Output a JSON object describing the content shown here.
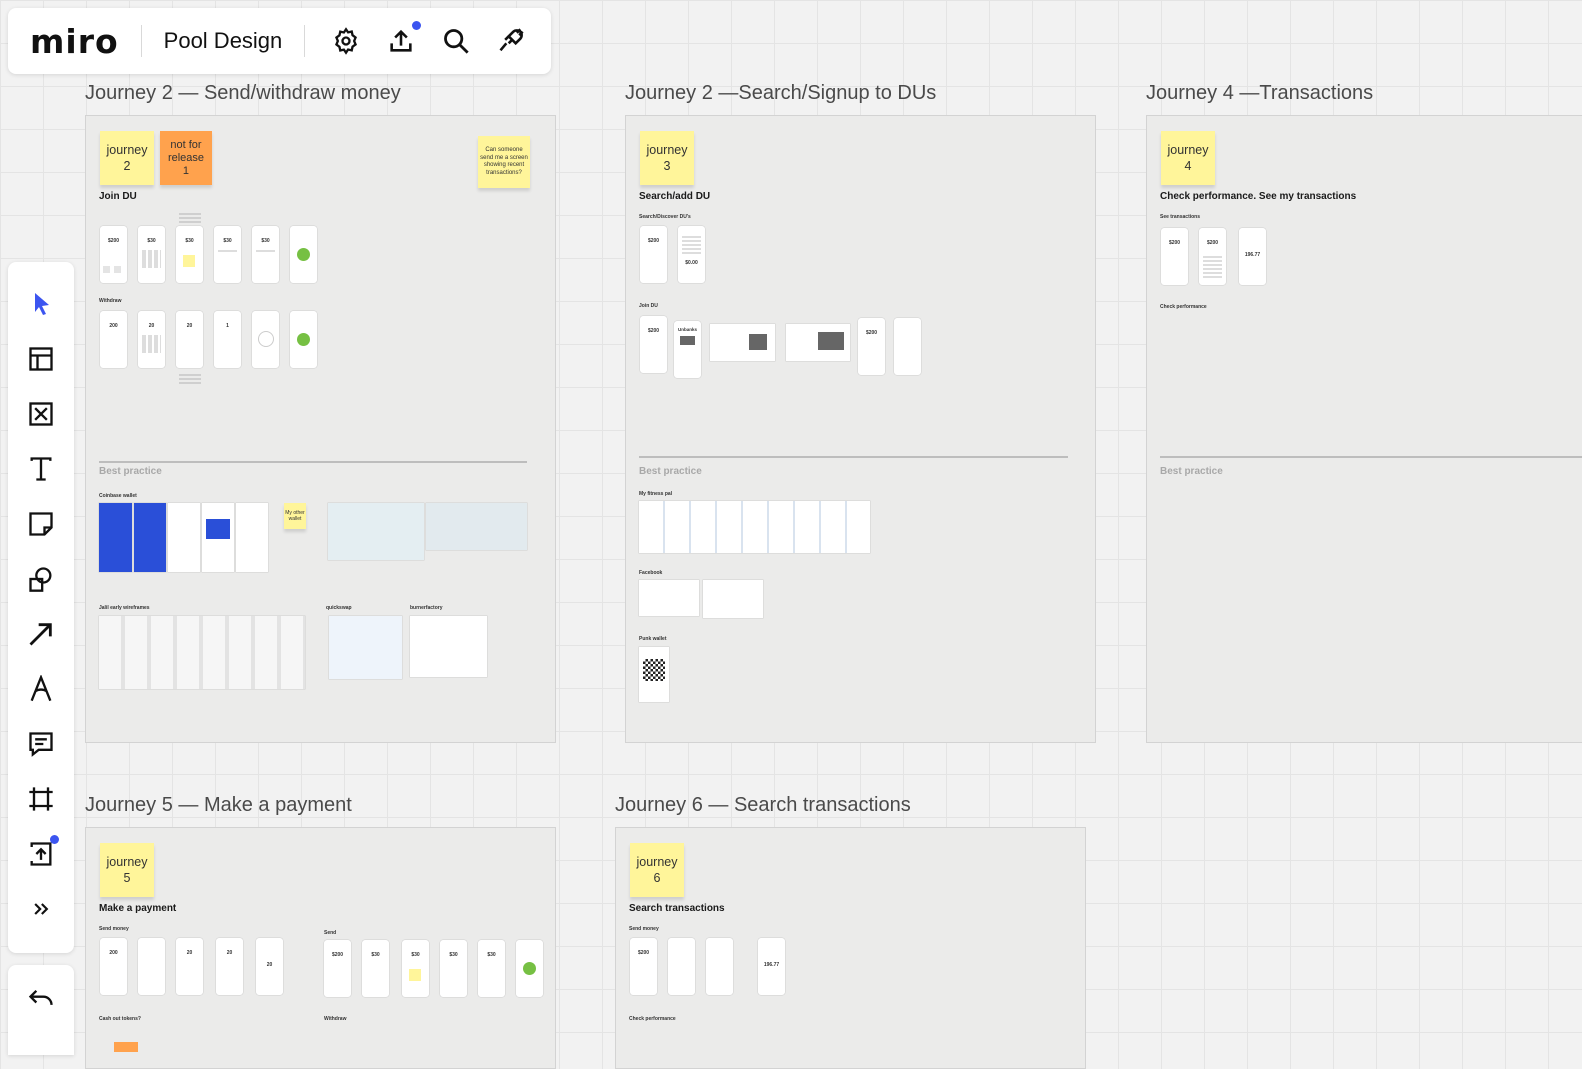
{
  "app": {
    "logo": "miro",
    "board_title": "Pool Design",
    "icons": [
      "gear-icon",
      "upload-icon",
      "search-icon",
      "plug-icon"
    ],
    "accent_color": "#3c55f0"
  },
  "left_toolbar": {
    "tools": [
      "select-cursor-icon",
      "templates-icon",
      "frame-cross-icon",
      "text-icon",
      "sticky-note-icon",
      "shapes-icon",
      "arrow-line-icon",
      "pen-icon",
      "comment-icon",
      "frame-crop-icon",
      "upload-icon",
      "more-chevrons-icon"
    ],
    "undo": "undo-icon"
  },
  "frames": {
    "j2": {
      "title": "Journey 2 — Send/withdraw money",
      "sticky1": "journey\n2",
      "sticky2": "not for\nrelease\n1",
      "sticky_note": "Can someone send me a screen showing recent transactions?",
      "heading": "Join DU",
      "withdraw_label": "Withdraw",
      "best_practice": "Best practice",
      "coinbase_label": "Coinbase wallet",
      "other_wallet": "My other wallet",
      "jalil_label": "Jalil early wireframes",
      "quickswap_label": "quickswap",
      "burner_label": "burnerfactory",
      "amounts": [
        "$200",
        "$30",
        "$30",
        "$30",
        "$30"
      ],
      "withdraw_amounts": [
        "200",
        "20",
        "20",
        "1"
      ]
    },
    "j3": {
      "title": "Journey 2 —Search/Signup to DUs",
      "sticky": "journey\n3",
      "heading": "Search/add DU",
      "search_label": "Search/Discover DU's",
      "join_label": "Join DU",
      "best_practice": "Best practice",
      "fitness_label": "My fitness pal",
      "facebook_label": "Facebook",
      "punk_label": "Punk wallet",
      "unbanks": "Unbanks",
      "amounts": [
        "$200",
        "$0.00",
        "$200",
        "$200"
      ]
    },
    "j4": {
      "title": "Journey 4 —Transactions",
      "sticky": "journey\n4",
      "heading": "Check performance. See my transactions",
      "see_label": "See transactions",
      "check_label": "Check performance",
      "best_practice": "Best practice",
      "amounts": [
        "$200",
        "$200",
        "196.77"
      ]
    },
    "j5": {
      "title": "Journey 5 — Make a payment",
      "sticky": "journey\n5",
      "heading": "Make a payment",
      "send_money_label": "Send money",
      "cash_out_label": "Cash out tokens?",
      "send_label": "Send",
      "withdraw_label": "Withdraw",
      "amounts": [
        "200",
        "20",
        "20",
        "20"
      ],
      "send_amounts": [
        "$200",
        "$30",
        "$30",
        "$30",
        "$30"
      ]
    },
    "j6": {
      "title": "Journey 6 — Search transactions",
      "sticky": "journey\n6",
      "heading": "Search transactions",
      "send_money_label": "Send money",
      "check_label": "Check performance",
      "amounts": [
        "$200",
        "196.77"
      ]
    }
  }
}
